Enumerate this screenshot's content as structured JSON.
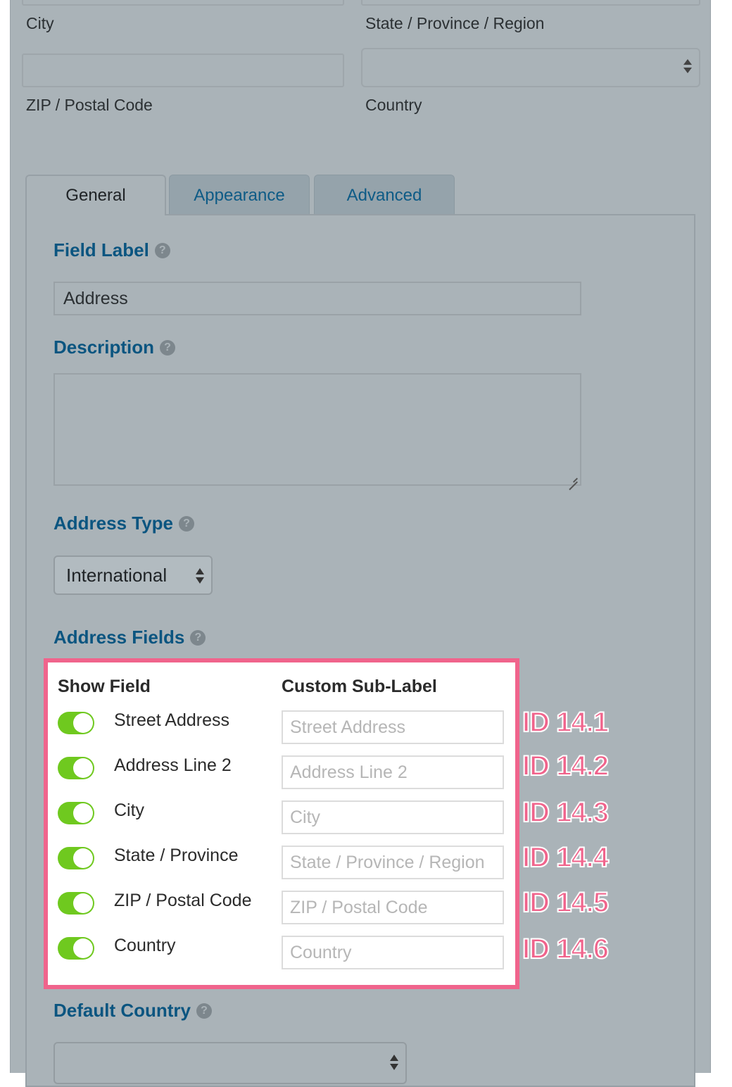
{
  "preview": {
    "city_label": "City",
    "state_label": "State / Province / Region",
    "zip_label": "ZIP / Postal Code",
    "country_label": "Country"
  },
  "tabs": [
    {
      "label": "General",
      "active": true
    },
    {
      "label": "Appearance",
      "active": false
    },
    {
      "label": "Advanced",
      "active": false
    }
  ],
  "field_label": {
    "title": "Field Label",
    "value": "Address"
  },
  "description": {
    "title": "Description",
    "value": ""
  },
  "address_type": {
    "title": "Address Type",
    "selected": "International"
  },
  "address_fields": {
    "title": "Address Fields",
    "col_show": "Show Field",
    "col_sublabel": "Custom Sub-Label",
    "rows": [
      {
        "label": "Street Address",
        "placeholder": "Street Address",
        "enabled": true,
        "id_tag": "ID 14.1"
      },
      {
        "label": "Address Line 2",
        "placeholder": "Address Line 2",
        "enabled": true,
        "id_tag": "ID 14.2"
      },
      {
        "label": "City",
        "placeholder": "City",
        "enabled": true,
        "id_tag": "ID 14.3"
      },
      {
        "label": "State / Province",
        "placeholder": "State / Province / Region",
        "enabled": true,
        "id_tag": "ID 14.4"
      },
      {
        "label": "ZIP / Postal Code",
        "placeholder": "ZIP / Postal Code",
        "enabled": true,
        "id_tag": "ID 14.5"
      },
      {
        "label": "Country",
        "placeholder": "Country",
        "enabled": true,
        "id_tag": "ID 14.6"
      }
    ]
  },
  "default_country": {
    "title": "Default Country",
    "selected": ""
  },
  "colors": {
    "accent_blue": "#0b5580",
    "toggle_on": "#6fc91f",
    "highlight_pink": "#f0648c"
  },
  "icons": {
    "help": "question-circle-icon",
    "select": "up-down-arrows-icon"
  }
}
